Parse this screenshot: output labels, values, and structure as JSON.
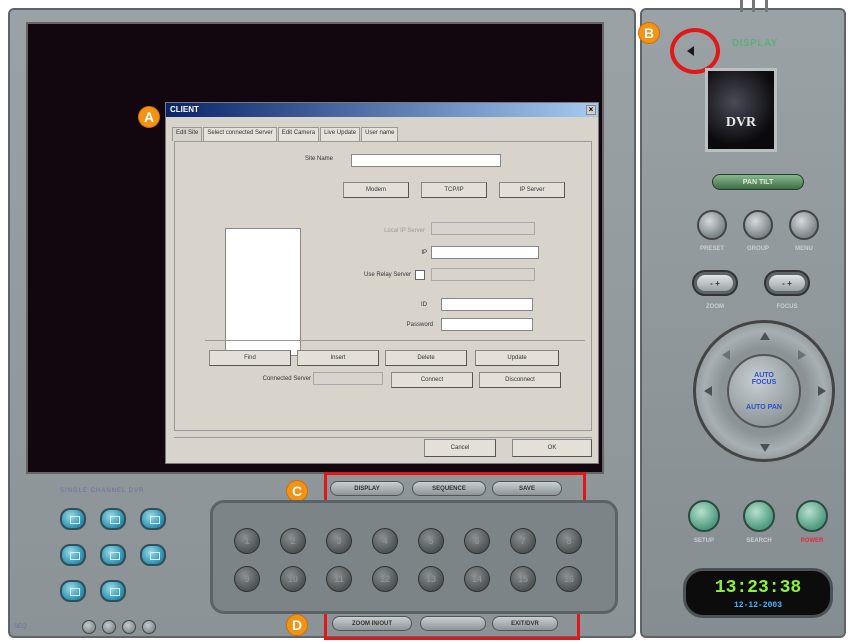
{
  "markers": {
    "a": "A",
    "b": "B",
    "c": "C",
    "d": "D"
  },
  "dialog": {
    "title": "CLIENT",
    "close": "×",
    "tabs": [
      "Edit Site",
      "Select connected Server",
      "Edit Camera",
      "Live Update",
      "User name"
    ],
    "site_name_label": "Site Name",
    "mode_buttons": [
      "Modem",
      "TCP/IP",
      "IP Server"
    ],
    "local_server_label": "Local IP Server",
    "ip_label": "IP",
    "relay_label": "Use Relay Server",
    "id_label": "ID",
    "password_label": "Password",
    "action_buttons": [
      "Find",
      "Insert",
      "Delete",
      "Update"
    ],
    "connected_label": "Connected Server",
    "connect": "Connect",
    "disconnect": "Disconnect",
    "cancel": "Cancel",
    "ok": "OK"
  },
  "control_bar": {
    "buttons": [
      "DISPLAY",
      "SEQUENCE",
      "SAVE"
    ]
  },
  "bottom_bar": {
    "buttons": [
      "ZOOM IN/OUT",
      "",
      "EXIT/DVR"
    ]
  },
  "layout": {
    "title": "SINGLE CHANNEL DVR",
    "seq_label": "SEQ"
  },
  "channels": [
    "1",
    "2",
    "3",
    "4",
    "5",
    "6",
    "7",
    "8",
    "9",
    "10",
    "11",
    "12",
    "13",
    "14",
    "15",
    "16"
  ],
  "right_panel": {
    "display_label": "DISPLAY",
    "logo_text": "DVR",
    "pan_tilt": "PAN TILT",
    "top_labels": [
      "PRESET",
      "GROUP",
      "MENU"
    ],
    "zoom_label": "ZOOM",
    "focus_label": "FOCUS",
    "zf_symbol": "- +",
    "ptz_center": [
      "AUTO FOCUS",
      "AUTO PAN"
    ],
    "bottom_labels": [
      "SETUP",
      "SEARCH",
      "POWER"
    ],
    "clock_time": "13:23:38",
    "clock_date": "12-12-2003"
  },
  "colors": {
    "accent_red": "#e01818",
    "marker_orange": "#f29315",
    "clock_green": "#8ef03a",
    "clock_blue": "#43b6ff",
    "power_red": "#e8283a"
  }
}
